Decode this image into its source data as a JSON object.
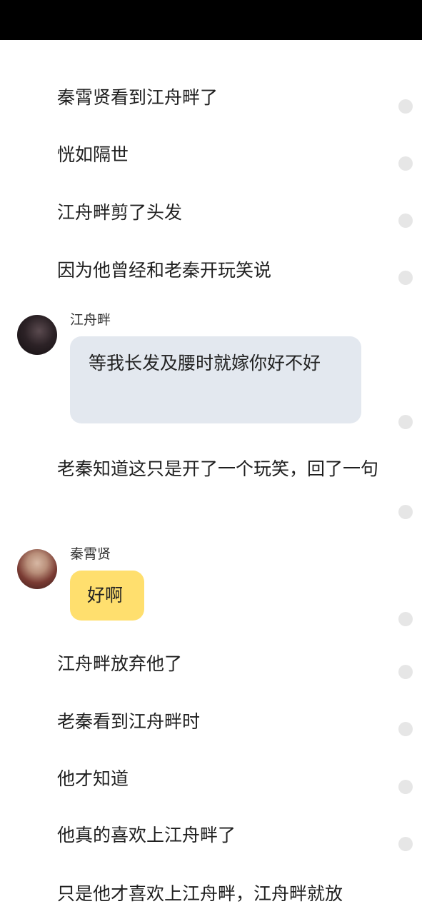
{
  "story": {
    "lines": [
      "秦霄贤看到江舟畔了",
      "恍如隔世",
      "江舟畔剪了头发",
      "因为他曾经和老秦开玩笑说"
    ],
    "chat1": {
      "speaker": "江舟畔",
      "message": "等我长发及腰时就嫁你好不好"
    },
    "narration_long": "老秦知道这只是开了一个玩笑，回了一句",
    "chat2": {
      "speaker": "秦霄贤",
      "message": "好啊"
    },
    "lines2": [
      "江舟畔放弃他了",
      "老秦看到江舟畔时",
      "他才知道",
      "他真的喜欢上江舟畔了",
      "只是他才喜欢上江舟畔，江舟畔就放"
    ]
  },
  "colors": {
    "status_bar": "#000000",
    "grey_bubble": "#e3e8ef",
    "yellow_bubble": "#ffdf6e",
    "comment_dot": "#e6e6e6"
  },
  "icons": [
    "comment-dot-icon",
    "avatar"
  ]
}
